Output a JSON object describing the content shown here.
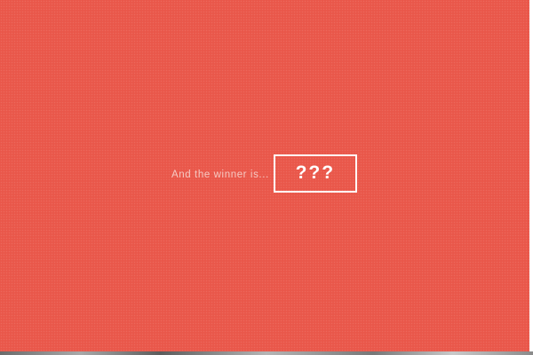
{
  "winner_reveal": {
    "lead_text": "And the winner is...",
    "answer": "???"
  },
  "colors": {
    "background": "#e9574a",
    "lead_text": "#f6c9c3",
    "box_border": "#ffffff",
    "answer_text": "#ffffff"
  }
}
